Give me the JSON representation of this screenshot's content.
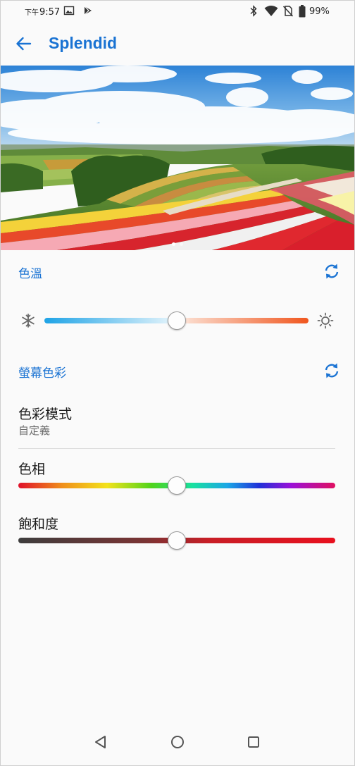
{
  "status_bar": {
    "ampm": "下午",
    "time": "9:57",
    "battery": "99%",
    "icons": [
      "gallery-icon",
      "play-store-icon",
      "bluetooth-icon",
      "wifi-icon",
      "no-sim-icon",
      "battery-icon"
    ]
  },
  "app_bar": {
    "title": "Splendid",
    "back_icon": "back-arrow-icon"
  },
  "hero": {
    "description_icon": "landscape-preview-image",
    "page_count": 2,
    "active_page": 1
  },
  "color_temperature": {
    "label": "色溫",
    "reset_icon": "refresh-icon",
    "left_icon": "snowflake-icon",
    "right_icon": "sun-icon",
    "value_percent": 50,
    "colors": [
      "#1ea3e6",
      "#ffffff",
      "#f0561e"
    ]
  },
  "screen_color": {
    "label": "螢幕色彩",
    "reset_icon": "refresh-icon",
    "color_mode": {
      "title": "色彩模式",
      "value": "自定義"
    },
    "hue": {
      "label": "色相",
      "value_percent": 50
    },
    "saturation": {
      "label": "飽和度",
      "value_percent": 50
    }
  },
  "nav_bar": {
    "back": "back-triangle-icon",
    "home": "home-circle-icon",
    "recents": "recents-square-icon"
  },
  "colors": {
    "accent": "#1a73d3"
  }
}
